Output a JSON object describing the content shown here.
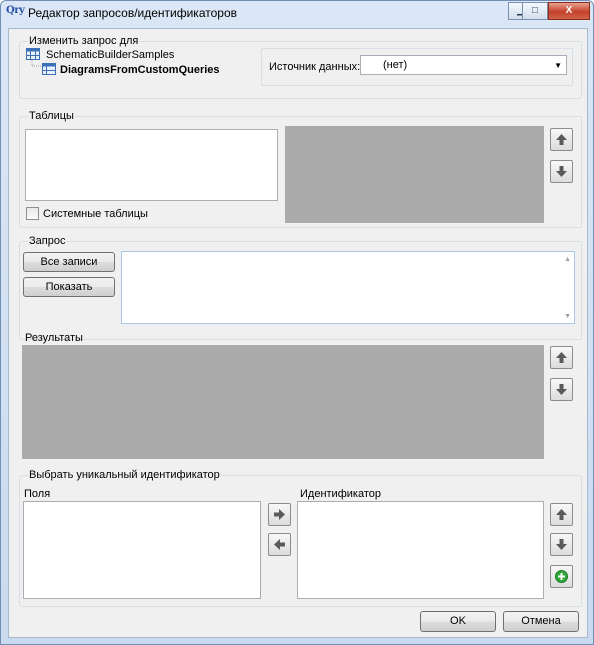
{
  "window": {
    "title": "Редактор запросов/идентификаторов",
    "icon_text": "Qry",
    "controls": {
      "minimize": "▁",
      "maximize": "□",
      "close": "X"
    }
  },
  "change_query": {
    "group_label": "Изменить запрос для",
    "tree": [
      {
        "label": "SchematicBuilderSamples",
        "icon": "database-icon",
        "bold": false
      },
      {
        "label": "DiagramsFromCustomQueries",
        "icon": "table-icon",
        "bold": true
      }
    ],
    "datasource_label": "Источник данных:",
    "datasource_value": "(нет)"
  },
  "tables": {
    "group_label": "Таблицы",
    "system_tables_label": "Системные таблицы",
    "system_tables_checked": false
  },
  "query": {
    "group_label": "Запрос",
    "all_records_button": "Все записи",
    "show_button": "Показать",
    "query_text": ""
  },
  "results": {
    "label": "Результаты"
  },
  "unique_id": {
    "group_label": "Выбрать уникальный идентификатор",
    "fields_label": "Поля",
    "identifier_label": "Идентификатор"
  },
  "footer": {
    "ok_button": "OK",
    "cancel_button": "Отмена"
  },
  "icons": {
    "move_up": "arrow-up-icon",
    "move_down": "arrow-down-icon",
    "move_right": "arrow-right-icon",
    "move_left": "arrow-left-icon",
    "add": "green-plus-icon"
  },
  "colors": {
    "gray_panel": "#ababab",
    "title_bar": "#c9daef",
    "client": "#f0f0f0"
  }
}
